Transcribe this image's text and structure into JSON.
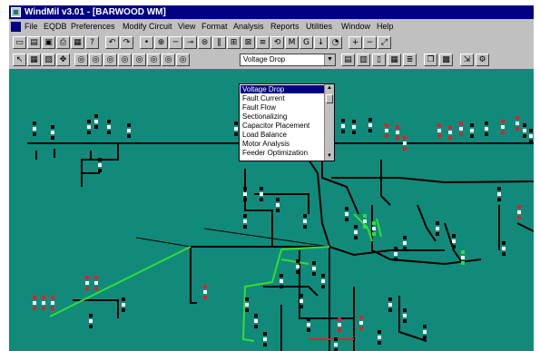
{
  "window": {
    "title": "WindMil v3.01 - [BARWOOD WM]"
  },
  "menu": [
    "File",
    "EQDB",
    "Preferences",
    "Modify Circuit",
    "View",
    "Format",
    "Analysis",
    "Reports",
    "Utilities",
    "Window",
    "Help"
  ],
  "toolbar1_icons": [
    "new-icon",
    "open-icon",
    "save-icon",
    "print-icon",
    "image-icon",
    "help-icon",
    "undo-icon",
    "redo-icon",
    "node-icon",
    "source-icon",
    "conductor-icon",
    "switch-icon",
    "transformer-icon",
    "capacitor-icon",
    "regulator-icon",
    "breaker-icon",
    "fuse-icon",
    "recloser-icon",
    "motor-icon",
    "generator-icon",
    "load-icon",
    "meter-icon",
    "zoom-in-icon",
    "zoom-out-icon",
    "zoom-fit-icon"
  ],
  "toolbar2_icons": [
    "select-icon",
    "grid-icon",
    "map-icon",
    "pan-icon",
    "tool-icon",
    "tool-icon",
    "tool-icon",
    "tool-icon",
    "tool-icon",
    "tool-icon",
    "tool-icon",
    "tool-icon"
  ],
  "toolbar2_right_icons": [
    "report-icon",
    "chart-icon",
    "page-icon",
    "table-icon",
    "list-icon",
    "copy-icon",
    "calc-icon",
    "export-icon",
    "settings-icon"
  ],
  "analysis_select": {
    "value": "Voltage Drop",
    "options": [
      "Voltage Drop",
      "Fault Current",
      "Fault Flow",
      "Sectionalizing",
      "Capacitor Placement",
      "Load Balance",
      "Motor Analysis",
      "Feeder Optimization"
    ]
  },
  "colors": {
    "canvas": "#118a7b",
    "lines": "#000000",
    "energized": "#33dd33",
    "overload": "#dd2222",
    "titlebar": "#000080"
  }
}
